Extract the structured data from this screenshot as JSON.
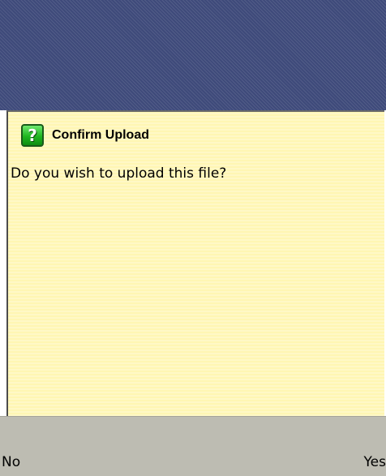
{
  "dialog": {
    "title": "Confirm Upload",
    "message": "Do you wish to upload this file?",
    "icon": "question-icon",
    "icon_glyph": "?"
  },
  "softkeys": {
    "left_label": "No",
    "right_label": "Yes"
  },
  "colors": {
    "backdrop": "#3e4a7a",
    "dialog_background": "#fff6b3",
    "icon_green": "#1fb51f",
    "softkey_bar": "#bdbcb2"
  }
}
